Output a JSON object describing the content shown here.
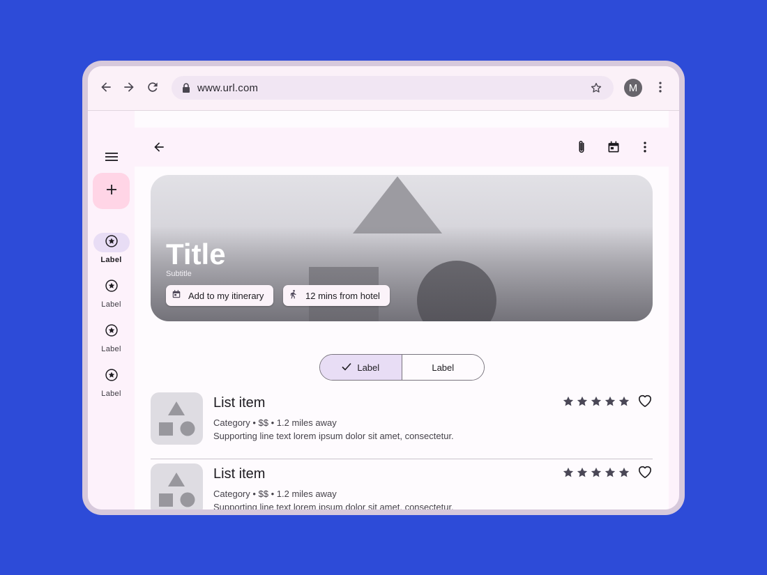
{
  "browser": {
    "url": "www.url.com",
    "avatar_letter": "M",
    "icons": [
      "back-arrow-icon",
      "forward-arrow-icon",
      "reload-icon",
      "lock-icon",
      "star-outline-icon",
      "more-vert-icon"
    ]
  },
  "nav_rail": {
    "icons": [
      "menu-icon",
      "plus-icon"
    ],
    "items": [
      {
        "label": "Label",
        "icon": "star-circle-icon",
        "active": true
      },
      {
        "label": "Label",
        "icon": "star-circle-icon",
        "active": false
      },
      {
        "label": "Label",
        "icon": "star-circle-icon",
        "active": false
      },
      {
        "label": "Label",
        "icon": "star-circle-icon",
        "active": false
      }
    ]
  },
  "top_app_bar": {
    "icons": [
      "back-arrow-icon",
      "attachment-icon",
      "calendar-icon",
      "more-vert-icon"
    ]
  },
  "hero": {
    "title": "Title",
    "subtitle": "Subtitle",
    "chips": [
      {
        "label": "Add to my itinerary",
        "icon": "calendar-icon"
      },
      {
        "label": "12 mins from hotel",
        "icon": "walking-icon"
      }
    ]
  },
  "segmented": {
    "options": [
      {
        "label": "Label",
        "selected": true
      },
      {
        "label": "Label",
        "selected": false
      }
    ]
  },
  "list": [
    {
      "title": "List item",
      "meta": "Category • $$ • 1.2 miles away",
      "support": "Supporting line text lorem ipsum dolor sit amet, consectetur.",
      "rating": 5
    },
    {
      "title": "List item",
      "meta": "Category • $$ • 1.2 miles away",
      "support": "Supporting line text lorem ipsum dolor sit amet, consectetur.",
      "rating": 5
    }
  ],
  "colors": {
    "background": "#2d4bd8",
    "device_frame": "#d7c9dc",
    "fab": "#ffd5e6",
    "selected": "#e8ddf5",
    "surface": "#fefbfe"
  }
}
